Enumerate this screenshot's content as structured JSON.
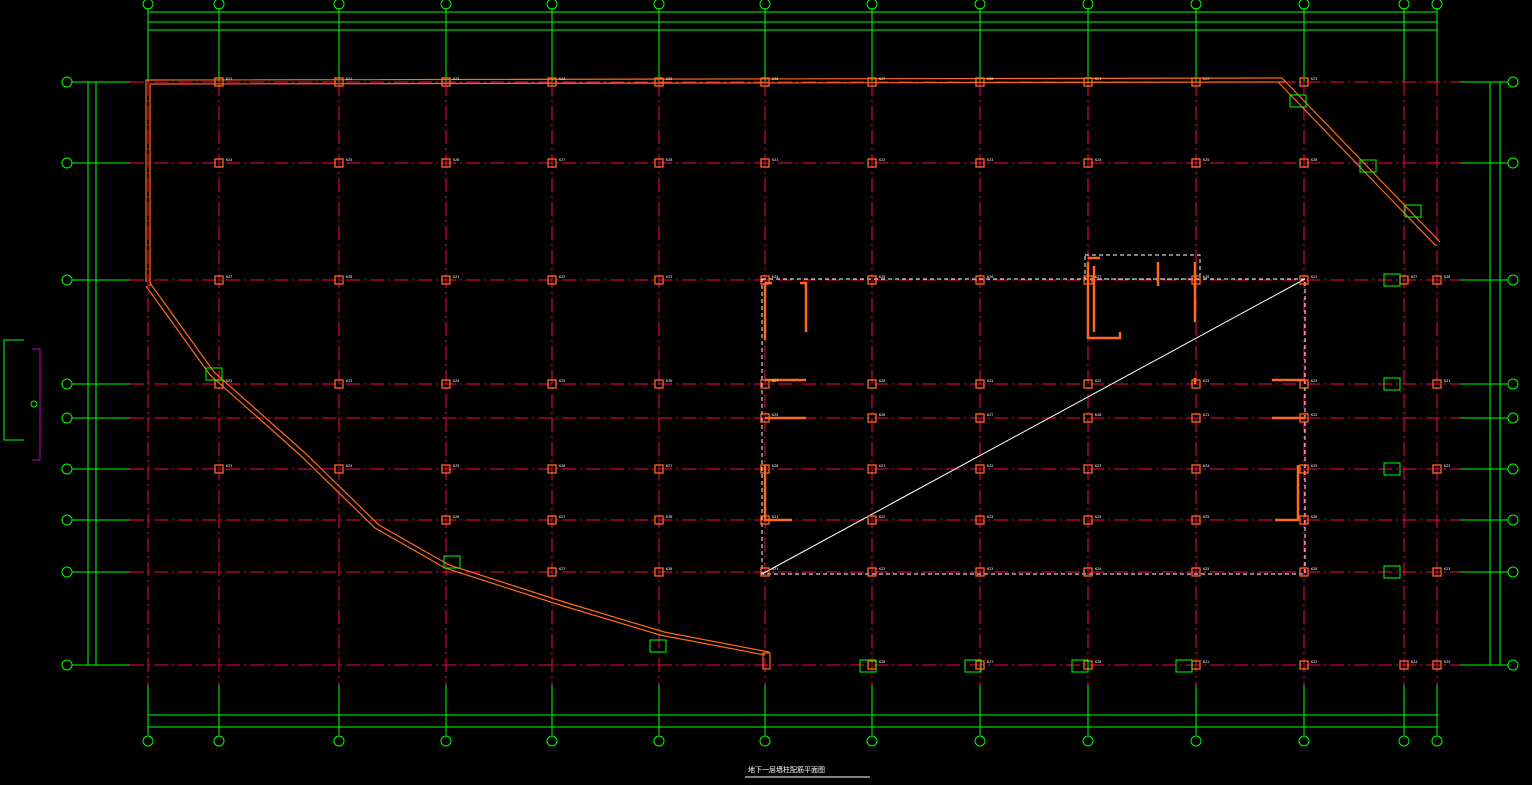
{
  "drawing": {
    "title": "地下一层墙柱配筋平面图",
    "colors": {
      "axis_line": "#ff0050",
      "dimension": "#00ff00",
      "wall": "#ff6a1a",
      "opening_outline": "#ffffff",
      "background": "#000000",
      "bracket": "#c000c0"
    }
  },
  "column_labels": [
    "KZ1",
    "KZ2",
    "KZ3",
    "KZ4",
    "KZ5",
    "KZ6",
    "KZ7",
    "KZ8"
  ]
}
